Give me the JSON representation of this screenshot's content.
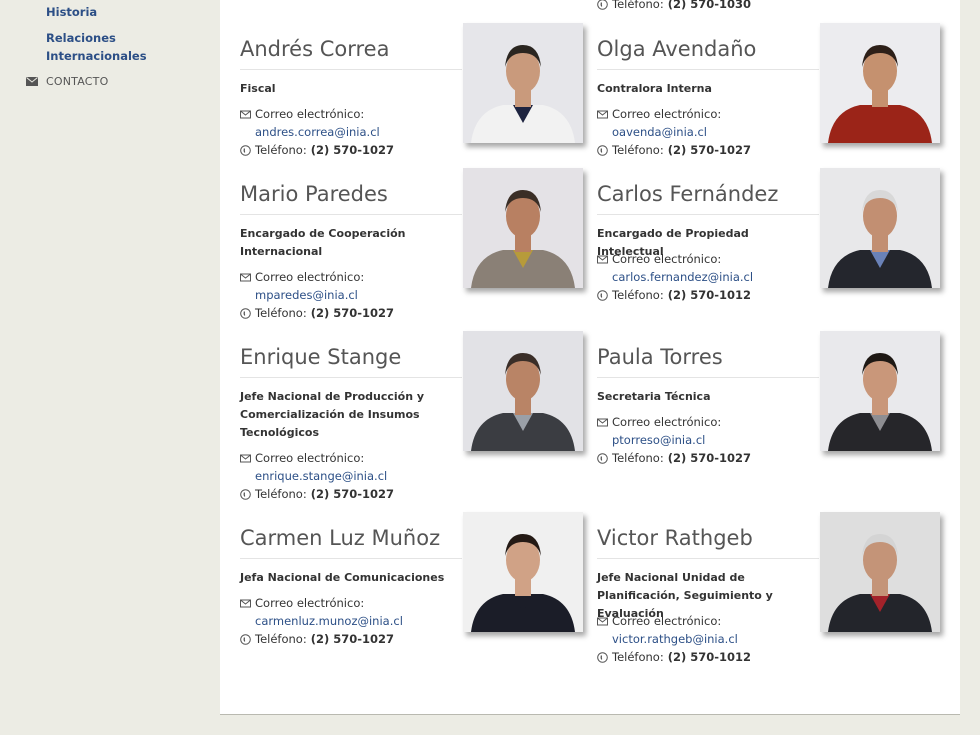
{
  "sidebar": {
    "items": [
      {
        "label": "Historia"
      },
      {
        "label": "Relaciones Internacionales"
      }
    ],
    "contact_label": "CONTACTO"
  },
  "labels": {
    "email_label": "Correo electrónico:",
    "phone_label": "Teléfono:"
  },
  "top_phone": "(2) 570-1030",
  "people": [
    {
      "name": "Andrés Correa",
      "role": "Fiscal",
      "email": "andres.correa@inia.cl",
      "phone": "(2) 570-1027",
      "photo": {
        "bg": "#e6e6ea",
        "skin": "#c99a7c",
        "hair": "#2a2520",
        "clothes": "#f2f2f2",
        "accent": "#1e2440"
      }
    },
    {
      "name": "Olga Avendaño",
      "role": "Contralora Interna",
      "email": "oavenda@inia.cl",
      "phone": "(2) 570-1027",
      "photo": {
        "bg": "#ececef",
        "skin": "#c5916f",
        "hair": "#2d1f18",
        "clothes": "#9b2418",
        "accent": "#9b2418"
      }
    },
    {
      "name": "Mario Paredes",
      "role": "Encargado de Cooperación Internacional",
      "email": "mparedes@inia.cl",
      "phone": "(2) 570-1027",
      "photo": {
        "bg": "#e4e2e6",
        "skin": "#b88062",
        "hair": "#3a2e26",
        "clothes": "#8a8076",
        "accent": "#b79b3a"
      }
    },
    {
      "name": "Carlos Fernández",
      "role": "Encargado de Propiedad Intelectual",
      "email": "carlos.fernandez@inia.cl",
      "phone": "(2) 570-1012",
      "photo": {
        "bg": "#e8e8ea",
        "skin": "#c28f72",
        "hair": "#d8d8d8",
        "clothes": "#24262d",
        "accent": "#6a82b8"
      }
    },
    {
      "name": "Enrique Stange",
      "role": "Jefe Nacional de Producción y Comercialización de Insumos Tecnológicos",
      "email": "enrique.stange@inia.cl",
      "phone": "(2) 570-1027",
      "photo": {
        "bg": "#e2e2e6",
        "skin": "#b98466",
        "hair": "#3a2e28",
        "clothes": "#3b3d42",
        "accent": "#9aa0a8"
      }
    },
    {
      "name": "Paula Torres",
      "role": "Secretaria Técnica",
      "email": "ptorreso@inia.cl",
      "phone": "(2) 570-1027",
      "photo": {
        "bg": "#e9e9ec",
        "skin": "#c9977a",
        "hair": "#1e1814",
        "clothes": "#26262a",
        "accent": "#8e8e92"
      }
    },
    {
      "name": "Carmen Luz Muñoz",
      "role": "Jefa Nacional de Comunicaciones",
      "email": "carmenluz.munoz@inia.cl",
      "phone": "(2) 570-1027",
      "photo": {
        "bg": "#f0f0f0",
        "skin": "#d0a286",
        "hair": "#241a15",
        "clothes": "#1b1d28",
        "accent": "#1b1d28"
      }
    },
    {
      "name": "Victor Rathgeb",
      "role": "Jefe Nacional Unidad de Planificación, Seguimiento y Evaluación",
      "email": "victor.rathgeb@inia.cl",
      "phone": "(2) 570-1012",
      "photo": {
        "bg": "#dedede",
        "skin": "#c49478",
        "hair": "#d4d4d4",
        "clothes": "#23252b",
        "accent": "#a3222a"
      }
    }
  ]
}
